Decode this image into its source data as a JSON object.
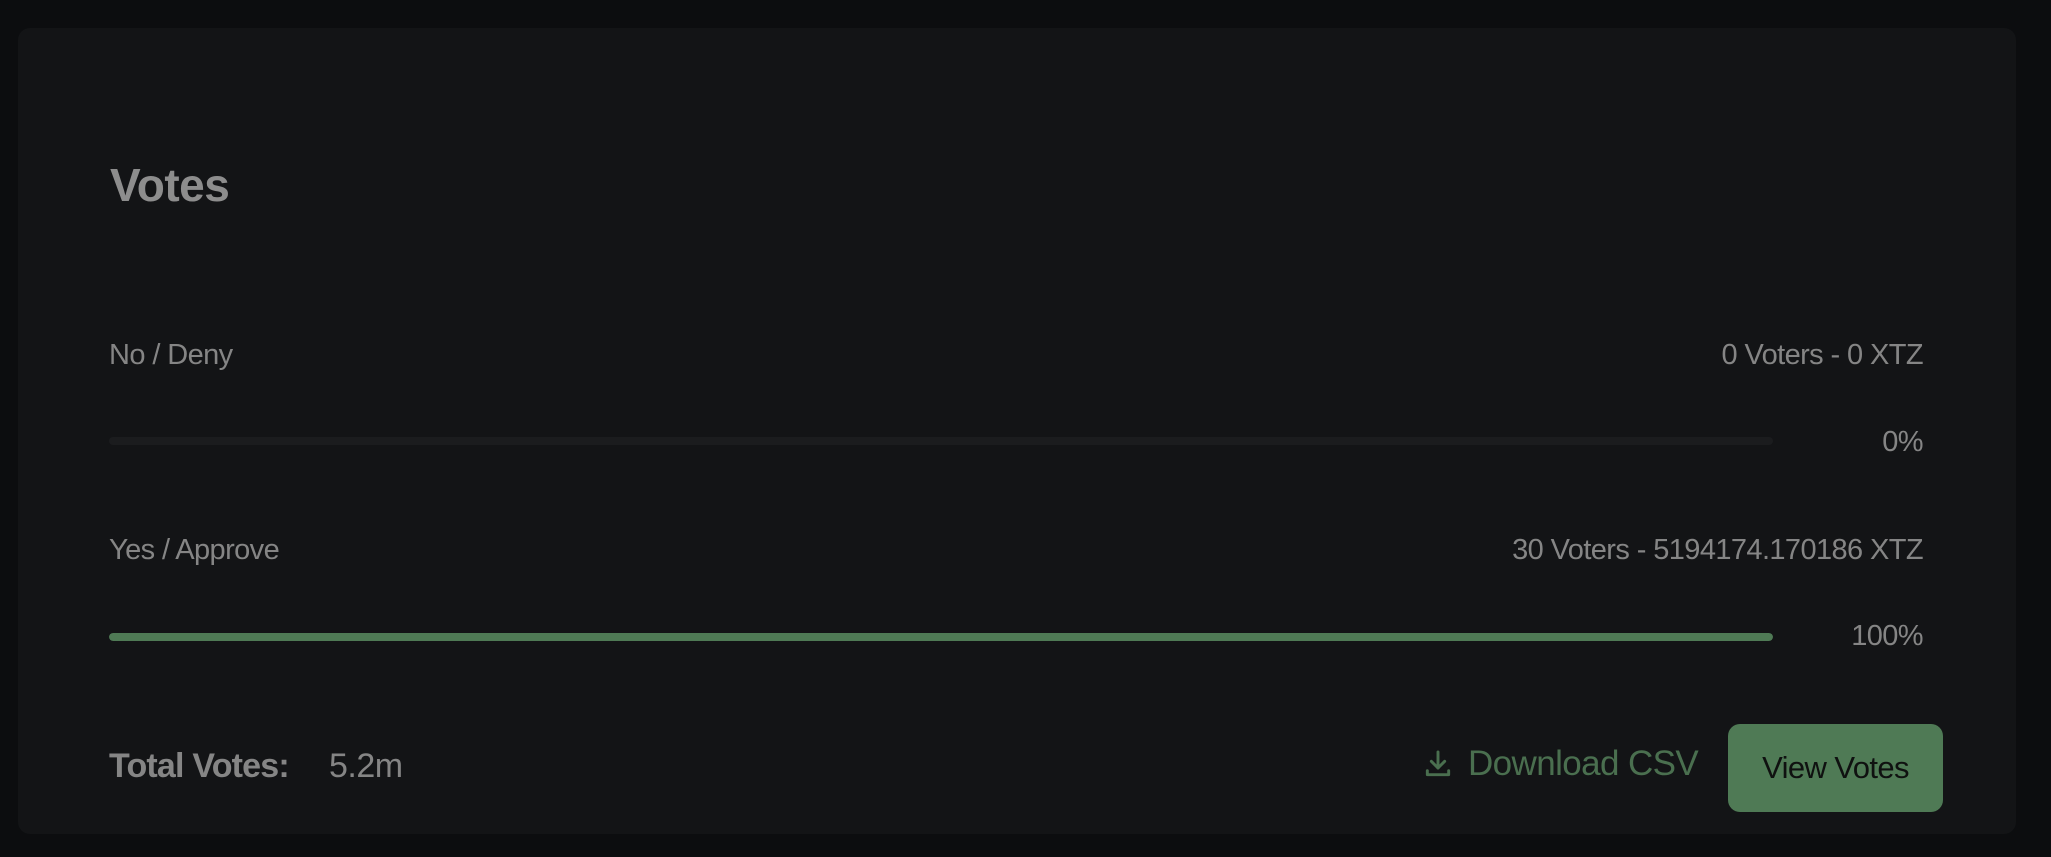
{
  "section": {
    "title": "Votes"
  },
  "votes": [
    {
      "label": "No / Deny",
      "detail": "0 Voters - 0 XTZ",
      "percent_label": "0%",
      "fraction": 0.0
    },
    {
      "label": "Yes / Approve",
      "detail": "30 Voters - 5194174.170186 XTZ",
      "percent_label": "100%",
      "fraction": 1.0
    }
  ],
  "totals": {
    "label": "Total Votes:",
    "value": "5.2m"
  },
  "actions": {
    "download_label": "Download CSV",
    "download_icon": "download-icon",
    "view_label": "View Votes"
  },
  "colors": {
    "accent": "#4f7a55",
    "background": "#0c0d0f",
    "card": "#131416",
    "text": "#858585"
  }
}
